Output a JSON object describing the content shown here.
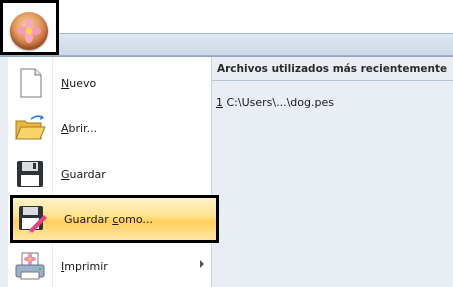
{
  "app_button": {
    "icon": "flower-orb-icon"
  },
  "menu": {
    "items": [
      {
        "label_mnemonic": "N",
        "label_rest": "uevo",
        "icon": "new-document-icon"
      },
      {
        "label_mnemonic": "A",
        "label_rest": "brir...",
        "icon": "open-folder-icon"
      },
      {
        "label_mnemonic": "G",
        "label_rest": "uardar",
        "icon": "floppy-disk-icon"
      },
      {
        "label_before": "Guardar ",
        "label_mnemonic": "c",
        "label_rest": "omo...",
        "icon": "save-as-icon",
        "highlighted": true
      },
      {
        "label_mnemonic": "I",
        "label_rest": "mprimir",
        "icon": "printer-icon",
        "has_submenu": true
      }
    ]
  },
  "recent": {
    "header": "Archivos utilizados más recientemente",
    "files": [
      {
        "index": "1",
        "path": " C:\\Users\\...\\dog.pes"
      }
    ]
  },
  "colors": {
    "highlight": "#ffd36b",
    "menu_background": "#e9eef5",
    "ribbon": "#d3dfeb"
  }
}
